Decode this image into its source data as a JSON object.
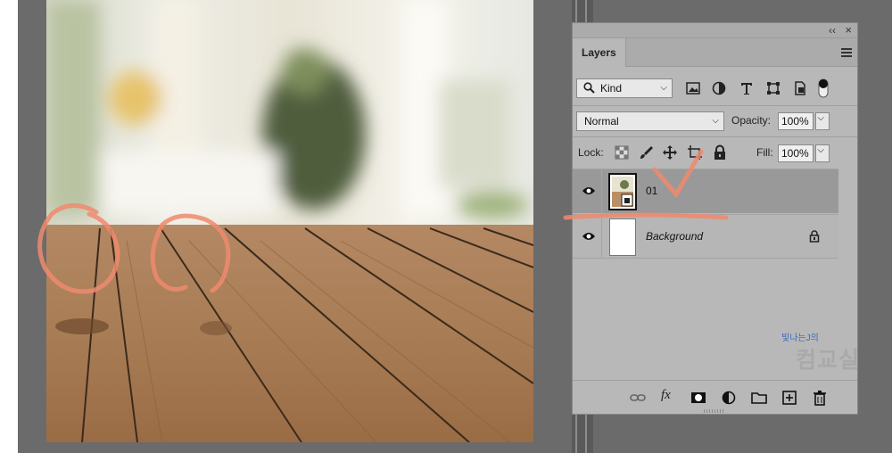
{
  "panel": {
    "collapse_glyph": "‹‹",
    "close_glyph": "×",
    "tab_label": "Layers"
  },
  "filter": {
    "kind_label": "Kind",
    "icons": [
      "image-filter-icon",
      "adjustment-filter-icon",
      "type-filter-icon",
      "shape-filter-icon",
      "smart-object-filter-icon",
      "filter-toggle-icon"
    ]
  },
  "blend": {
    "mode": "Normal",
    "opacity_label": "Opacity:",
    "opacity_value": "100%"
  },
  "lock": {
    "label": "Lock:",
    "icons": [
      "lock-transparent-pixels-icon",
      "lock-image-pixels-icon",
      "lock-position-icon",
      "lock-artboard-icon",
      "lock-all-icon"
    ],
    "fill_label": "Fill:",
    "fill_value": "100%"
  },
  "layers": [
    {
      "name": "01",
      "selected": true,
      "type": "smart-object"
    },
    {
      "name": "Background",
      "selected": false,
      "locked": true
    }
  ],
  "footer": {
    "fx_label": "fx",
    "icons": [
      "link-layers-icon",
      "layer-style-icon",
      "layer-mask-icon",
      "adjustment-layer-icon",
      "group-folder-icon",
      "new-layer-icon",
      "delete-trash-icon"
    ]
  },
  "watermark": {
    "small": "빛나는J의",
    "big": "컴교실"
  },
  "colors": {
    "pasteboard": "#6b6b6b",
    "panel": "#b8b8b8",
    "selected_layer": "#999999",
    "annotation": "#f08a6e"
  }
}
